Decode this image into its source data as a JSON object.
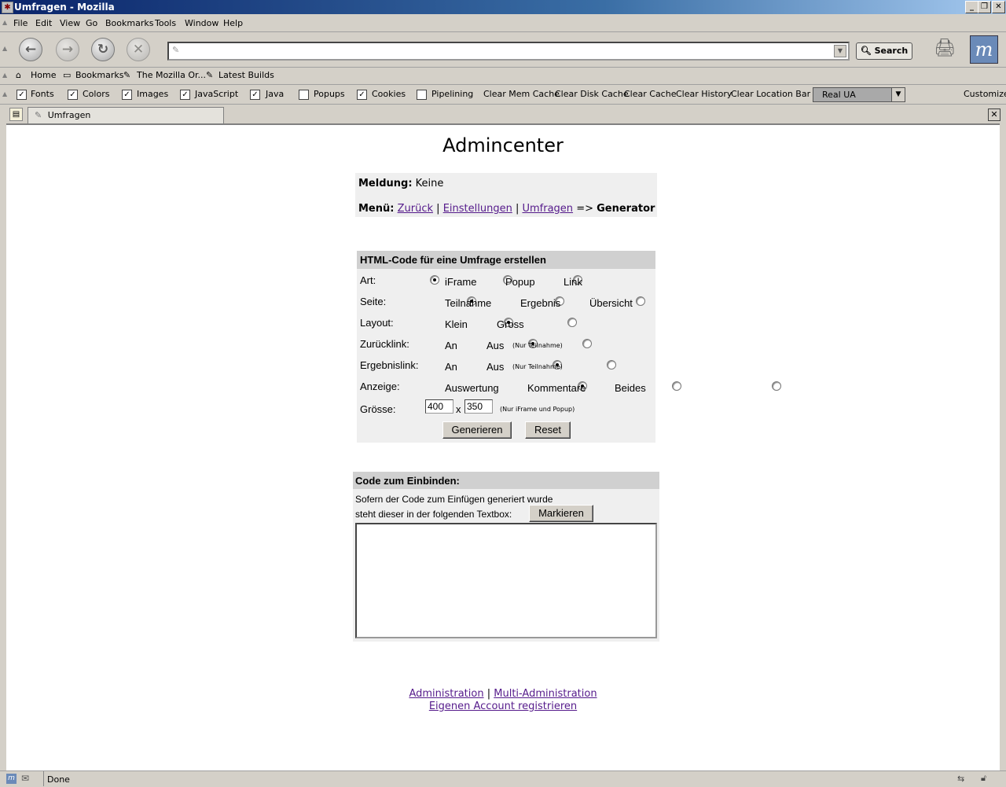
{
  "window": {
    "title": "Umfragen - Mozilla",
    "min": "_",
    "max": "❐",
    "close": "✕"
  },
  "menu": {
    "items": [
      "File",
      "Edit",
      "View",
      "Go",
      "Bookmarks",
      "Tools",
      "Window",
      "Help"
    ]
  },
  "nav": {
    "url": "",
    "search_label": "Search"
  },
  "personal_toolbar": {
    "items": [
      "Home",
      "Bookmarks",
      "The Mozilla Or...",
      "Latest Builds"
    ]
  },
  "prefbar": {
    "checkboxes": [
      {
        "label": "Fonts",
        "checked": true
      },
      {
        "label": "Colors",
        "checked": true
      },
      {
        "label": "Images",
        "checked": true
      },
      {
        "label": "JavaScript",
        "checked": true
      },
      {
        "label": "Java",
        "checked": true
      },
      {
        "label": "Popups",
        "checked": false
      },
      {
        "label": "Cookies",
        "checked": true
      },
      {
        "label": "Pipelining",
        "checked": false
      }
    ],
    "buttons": [
      "Clear Mem Cache",
      "Clear Disk Cache",
      "Clear Cache",
      "Clear History",
      "Clear Location Bar"
    ],
    "ua_select": "Real UA",
    "customize": "Customize"
  },
  "tabs": [
    {
      "label": "Umfragen"
    }
  ],
  "page": {
    "title": "Admincenter",
    "meldung_label": "Meldung:",
    "meldung_value": "Keine",
    "menu_label": "Menü:",
    "menu_links": [
      "Zurück",
      "Einstellungen",
      "Umfragen"
    ],
    "menu_sep": "|",
    "menu_arrow": "=>",
    "menu_current": "Generator",
    "form": {
      "heading": "HTML-Code für eine Umfrage erstellen",
      "rows": [
        {
          "label": "Art:",
          "options": [
            "iFrame",
            "Popup",
            "Link"
          ],
          "selected": 0,
          "note": ""
        },
        {
          "label": "Seite:",
          "options": [
            "Teilnahme",
            "Ergebnis",
            "Übersicht"
          ],
          "selected": 0,
          "note": ""
        },
        {
          "label": "Layout:",
          "options": [
            "Klein",
            "Gross"
          ],
          "selected": 0,
          "note": ""
        },
        {
          "label": "Zurücklink:",
          "options": [
            "An",
            "Aus"
          ],
          "selected": 0,
          "note": "(Nur Teilnahme)"
        },
        {
          "label": "Ergebnislink:",
          "options": [
            "An",
            "Aus"
          ],
          "selected": 0,
          "note": "(Nur Teilnahme)"
        },
        {
          "label": "Anzeige:",
          "options": [
            "Auswertung",
            "Kommentare",
            "Beides"
          ],
          "selected": 0,
          "note": ""
        }
      ],
      "size_label": "Grösse:",
      "width": "400",
      "x": "x",
      "height": "350",
      "size_note": "(Nur iFrame und Popup)",
      "generate": "Generieren",
      "reset": "Reset"
    },
    "code": {
      "heading": "Code zum Einbinden:",
      "line1": "Sofern der Code zum Einfügen generiert wurde",
      "line2": "steht dieser in der folgenden Textbox:",
      "mark_button": "Markieren",
      "textarea": ""
    },
    "footer": {
      "link1": "Administration",
      "sep": "|",
      "link2": "Multi-Administration",
      "link3": "Eigenen Account registrieren"
    }
  },
  "status": {
    "text": "Done"
  },
  "colors": {
    "panel_bg": "#efefef",
    "heading_bg": "#d0d0d0",
    "link": "#551a8b"
  }
}
